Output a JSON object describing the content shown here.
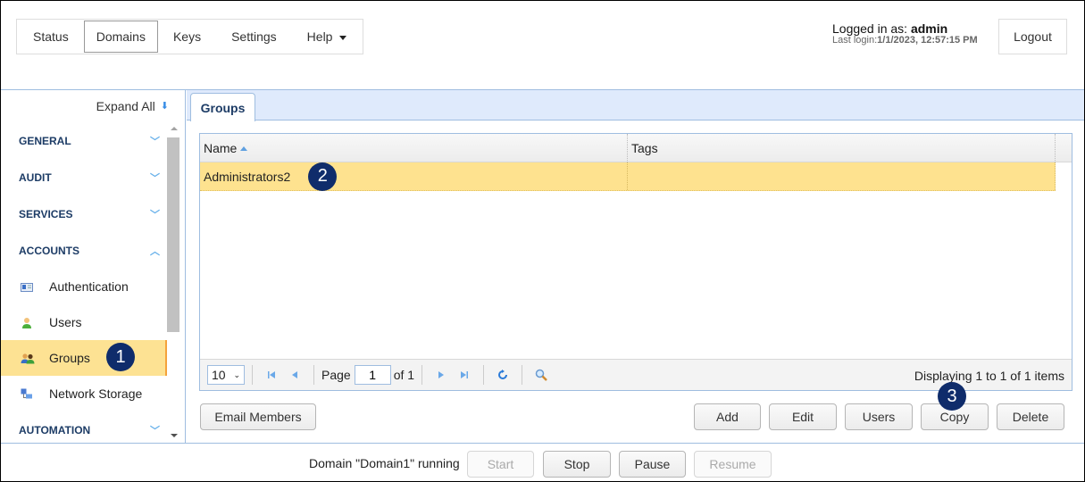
{
  "topnav": {
    "items": [
      {
        "label": "Status",
        "active": false
      },
      {
        "label": "Domains",
        "active": true
      },
      {
        "label": "Keys",
        "active": false
      },
      {
        "label": "Settings",
        "active": false
      },
      {
        "label": "Help",
        "active": false,
        "dropdown": true
      }
    ]
  },
  "session": {
    "logged_in_prefix": "Logged in as: ",
    "username": "admin",
    "last_login_prefix": "Last login:",
    "last_login_value": "1/1/2023, 12:57:15 PM",
    "logout_label": "Logout"
  },
  "sidebar": {
    "expand_all_label": "Expand All",
    "sections": [
      {
        "label": "GENERAL",
        "icon": "double-chevron-down-icon",
        "expanded": false
      },
      {
        "label": "AUDIT",
        "icon": "double-chevron-down-icon",
        "expanded": false
      },
      {
        "label": "SERVICES",
        "icon": "double-chevron-down-icon",
        "expanded": false
      },
      {
        "label": "ACCOUNTS",
        "icon": "double-chevron-up-icon",
        "expanded": true
      },
      {
        "label": "AUTOMATION",
        "icon": "double-chevron-down-icon",
        "expanded": false
      }
    ],
    "accounts_items": [
      {
        "label": "Authentication",
        "icon": "id-card-icon",
        "selected": false
      },
      {
        "label": "Users",
        "icon": "user-icon",
        "selected": false
      },
      {
        "label": "Groups",
        "icon": "group-icon",
        "selected": true
      },
      {
        "label": "Network Storage",
        "icon": "network-storage-icon",
        "selected": false
      }
    ]
  },
  "main": {
    "tab_label": "Groups",
    "grid": {
      "columns": [
        {
          "label": "Name",
          "sort": "ascending"
        },
        {
          "label": "Tags"
        }
      ],
      "rows": [
        {
          "name": "Administrators2",
          "tags": "",
          "selected": true
        }
      ],
      "pager": {
        "page_size": "10",
        "page_label": "Page",
        "page_value": "1",
        "of_label": "of 1",
        "display_info": "Displaying 1 to 1 of 1 items"
      }
    },
    "buttons": {
      "email_members": "Email Members",
      "add": "Add",
      "edit": "Edit",
      "users": "Users",
      "copy": "Copy",
      "delete": "Delete"
    }
  },
  "annotations": {
    "step1": "1",
    "step2": "2",
    "step3": "3"
  },
  "footer": {
    "status_text": "Domain \"Domain1\" running",
    "start_label": "Start",
    "stop_label": "Stop",
    "pause_label": "Pause",
    "resume_label": "Resume"
  },
  "colors": {
    "selection": "#fee28f",
    "accent_border": "#9fbde0",
    "badge": "#0f2c6b",
    "section_text": "#1d3c66"
  }
}
